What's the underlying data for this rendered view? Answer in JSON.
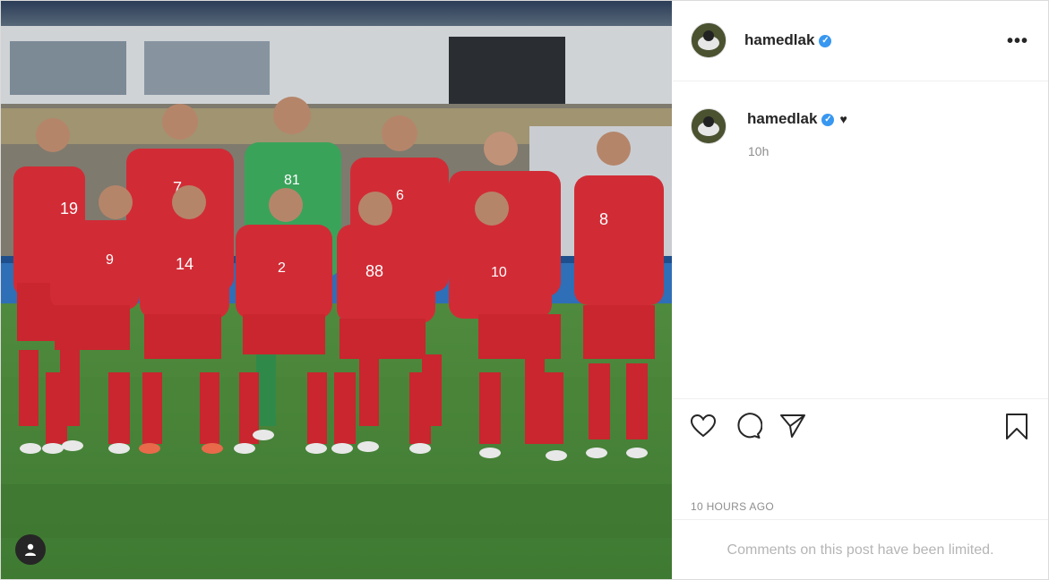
{
  "post": {
    "username": "hamedlak",
    "verified_mark": "✓",
    "more_label": "•••",
    "caption": {
      "username": "hamedlak",
      "text": "♥",
      "age": "10h"
    },
    "timestamp": "10 HOURS AGO",
    "comments_limited": "Comments on this post have been limited."
  },
  "photo": {
    "jerseys": [
      "19",
      "7",
      "81",
      "6",
      "8",
      "9",
      "14",
      "2",
      "88",
      "10"
    ]
  },
  "icons": {
    "like": "heart-icon",
    "comment": "comment-icon",
    "share": "paper-plane-icon",
    "save": "bookmark-icon",
    "tags": "user-tag-icon",
    "more": "more-options-icon"
  },
  "colors": {
    "verified": "#3897f0",
    "text": "#262626",
    "muted": "#8e8e8e",
    "jersey": "#d32f38",
    "keeper": "#3aa35a"
  }
}
